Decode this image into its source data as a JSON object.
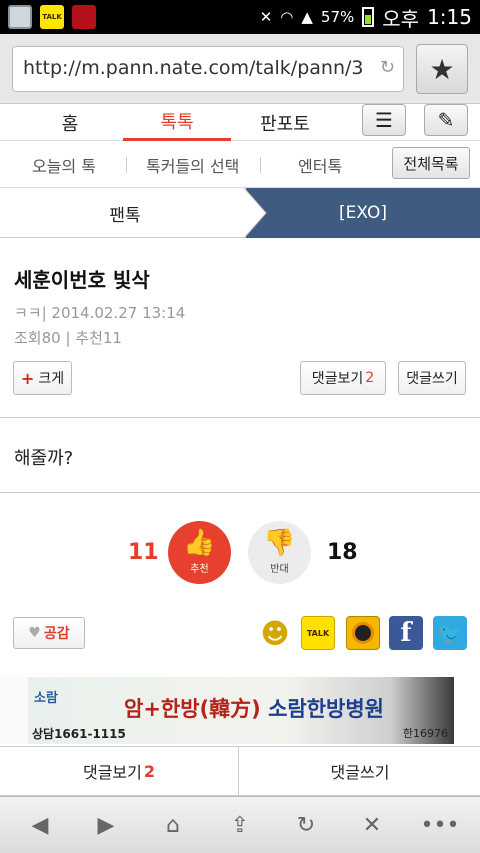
{
  "status_bar": {
    "battery": "57%",
    "ampm": "오후",
    "time": "1:15",
    "left_icons": [
      "gallery-icon",
      "kakaotalk-icon",
      "app-icon"
    ],
    "talk_badge": "TALK"
  },
  "browser": {
    "url": "http://m.pann.nate.com/talk/pann/3",
    "bookmark_icon": "star-icon"
  },
  "top_nav": {
    "items": [
      {
        "label": "홈",
        "active": false
      },
      {
        "label": "톡톡",
        "active": true
      },
      {
        "label": "판포토",
        "active": false
      }
    ]
  },
  "sub_nav": {
    "items": [
      "오늘의 톡",
      "톡커들의 선택",
      "엔터톡"
    ],
    "all_list": "전체목록"
  },
  "breadcrumb": {
    "left": "팬톡",
    "right": "[EXO]"
  },
  "post": {
    "title": "세훈이번호 빛삭",
    "author_date": "ㅋㅋ|  2014.02.27 13:14",
    "stats": "조회80 | 추천11",
    "body": "해줄까?"
  },
  "actions": {
    "bigger_label": "크게",
    "view_comments_label": "댓글보기",
    "comment_count": "2",
    "write_comment_label": "댓글쓰기"
  },
  "votes": {
    "up_count": "11",
    "up_label": "추천",
    "down_label": "반대",
    "down_count": "18"
  },
  "like": {
    "label": "공감"
  },
  "share": {
    "talk_label": "TALK",
    "facebook_glyph": "f",
    "icons": [
      "me2day-icon",
      "kakaotalk-share-icon",
      "kakaostory-share-icon",
      "facebook-share-icon",
      "twitter-share-icon"
    ]
  },
  "ad": {
    "logo": "소람",
    "phone": "상담1661-1115",
    "main_red": "암+한방(韓方)",
    "main_blue": "소람한방병원",
    "foot": "한16976"
  },
  "comment_bar": {
    "view_label": "댓글보기",
    "count": "2",
    "write_label": "댓글쓰기"
  },
  "toolbar": {
    "icons": [
      "back-icon",
      "forward-icon",
      "home-icon",
      "share-icon",
      "reload-icon",
      "close-icon",
      "more-icon"
    ]
  },
  "colors": {
    "accent_red": "#e53c2b",
    "breadcrumb_blue": "#3f5c80"
  }
}
